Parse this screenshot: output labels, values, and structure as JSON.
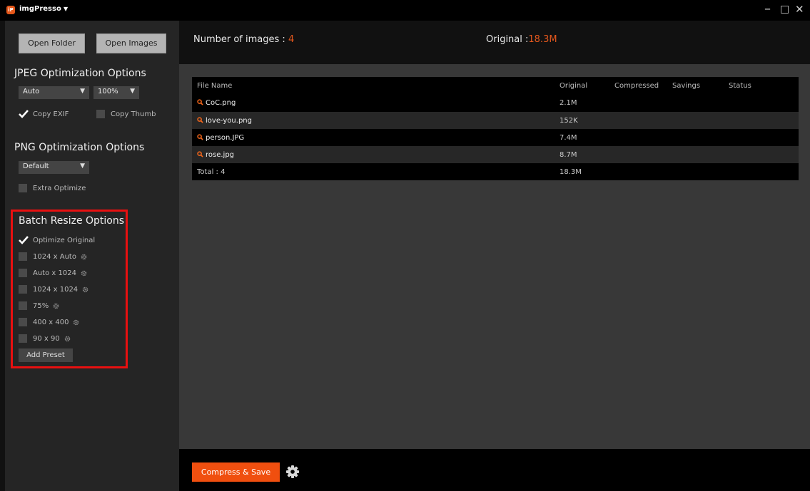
{
  "app": {
    "logo_text": "iP",
    "title": "imgPresso",
    "caret": "▼",
    "win_minimize": "–",
    "win_maximize": "□",
    "win_close": "✕"
  },
  "sidebar": {
    "open_folder": "Open Folder",
    "open_images": "Open Images",
    "jpeg": {
      "title": "JPEG Optimization Options",
      "mode_value": "Auto",
      "quality_value": "100%",
      "copy_exif_label": "Copy EXIF",
      "copy_exif_checked": true,
      "copy_thumb_label": "Copy Thumb",
      "copy_thumb_checked": false
    },
    "png": {
      "title": "PNG Optimization Options",
      "mode_value": "Default",
      "extra_optimize_label": "Extra Optimize",
      "extra_optimize_checked": false
    },
    "resize": {
      "title": "Batch Resize Options",
      "presets": [
        {
          "label": "Optimize Original",
          "checked": true,
          "has_settings": false
        },
        {
          "label": "1024 x Auto",
          "checked": false,
          "has_settings": true
        },
        {
          "label": "Auto x 1024",
          "checked": false,
          "has_settings": true
        },
        {
          "label": "1024 x 1024",
          "checked": false,
          "has_settings": true
        },
        {
          "label": "75%",
          "checked": false,
          "has_settings": true
        },
        {
          "label": "400 x 400",
          "checked": false,
          "has_settings": true
        },
        {
          "label": "90 x 90",
          "checked": false,
          "has_settings": true
        }
      ],
      "add_preset": "Add Preset"
    }
  },
  "stats": {
    "count_label": "Number of images :",
    "count_value": "4",
    "original_label": "Original :",
    "original_value": "18.3M"
  },
  "table": {
    "headers": {
      "file_name": "File Name",
      "original": "Original",
      "compressed": "Compressed",
      "savings": "Savings",
      "status": "Status"
    },
    "rows": [
      {
        "name": "CoC.png",
        "original": "2.1M",
        "compressed": "",
        "savings": "",
        "status": ""
      },
      {
        "name": "love-you.png",
        "original": "152K",
        "compressed": "",
        "savings": "",
        "status": ""
      },
      {
        "name": "person.JPG",
        "original": "7.4M",
        "compressed": "",
        "savings": "",
        "status": ""
      },
      {
        "name": "rose.jpg",
        "original": "8.7M",
        "compressed": "",
        "savings": "",
        "status": ""
      }
    ],
    "total_label": "Total : 4",
    "total_original": "18.3M"
  },
  "footer": {
    "compress_save": "Compress & Save"
  },
  "colors": {
    "accent": "#f04f0f",
    "highlight": "#e81010",
    "orange_text": "#e5581d"
  }
}
